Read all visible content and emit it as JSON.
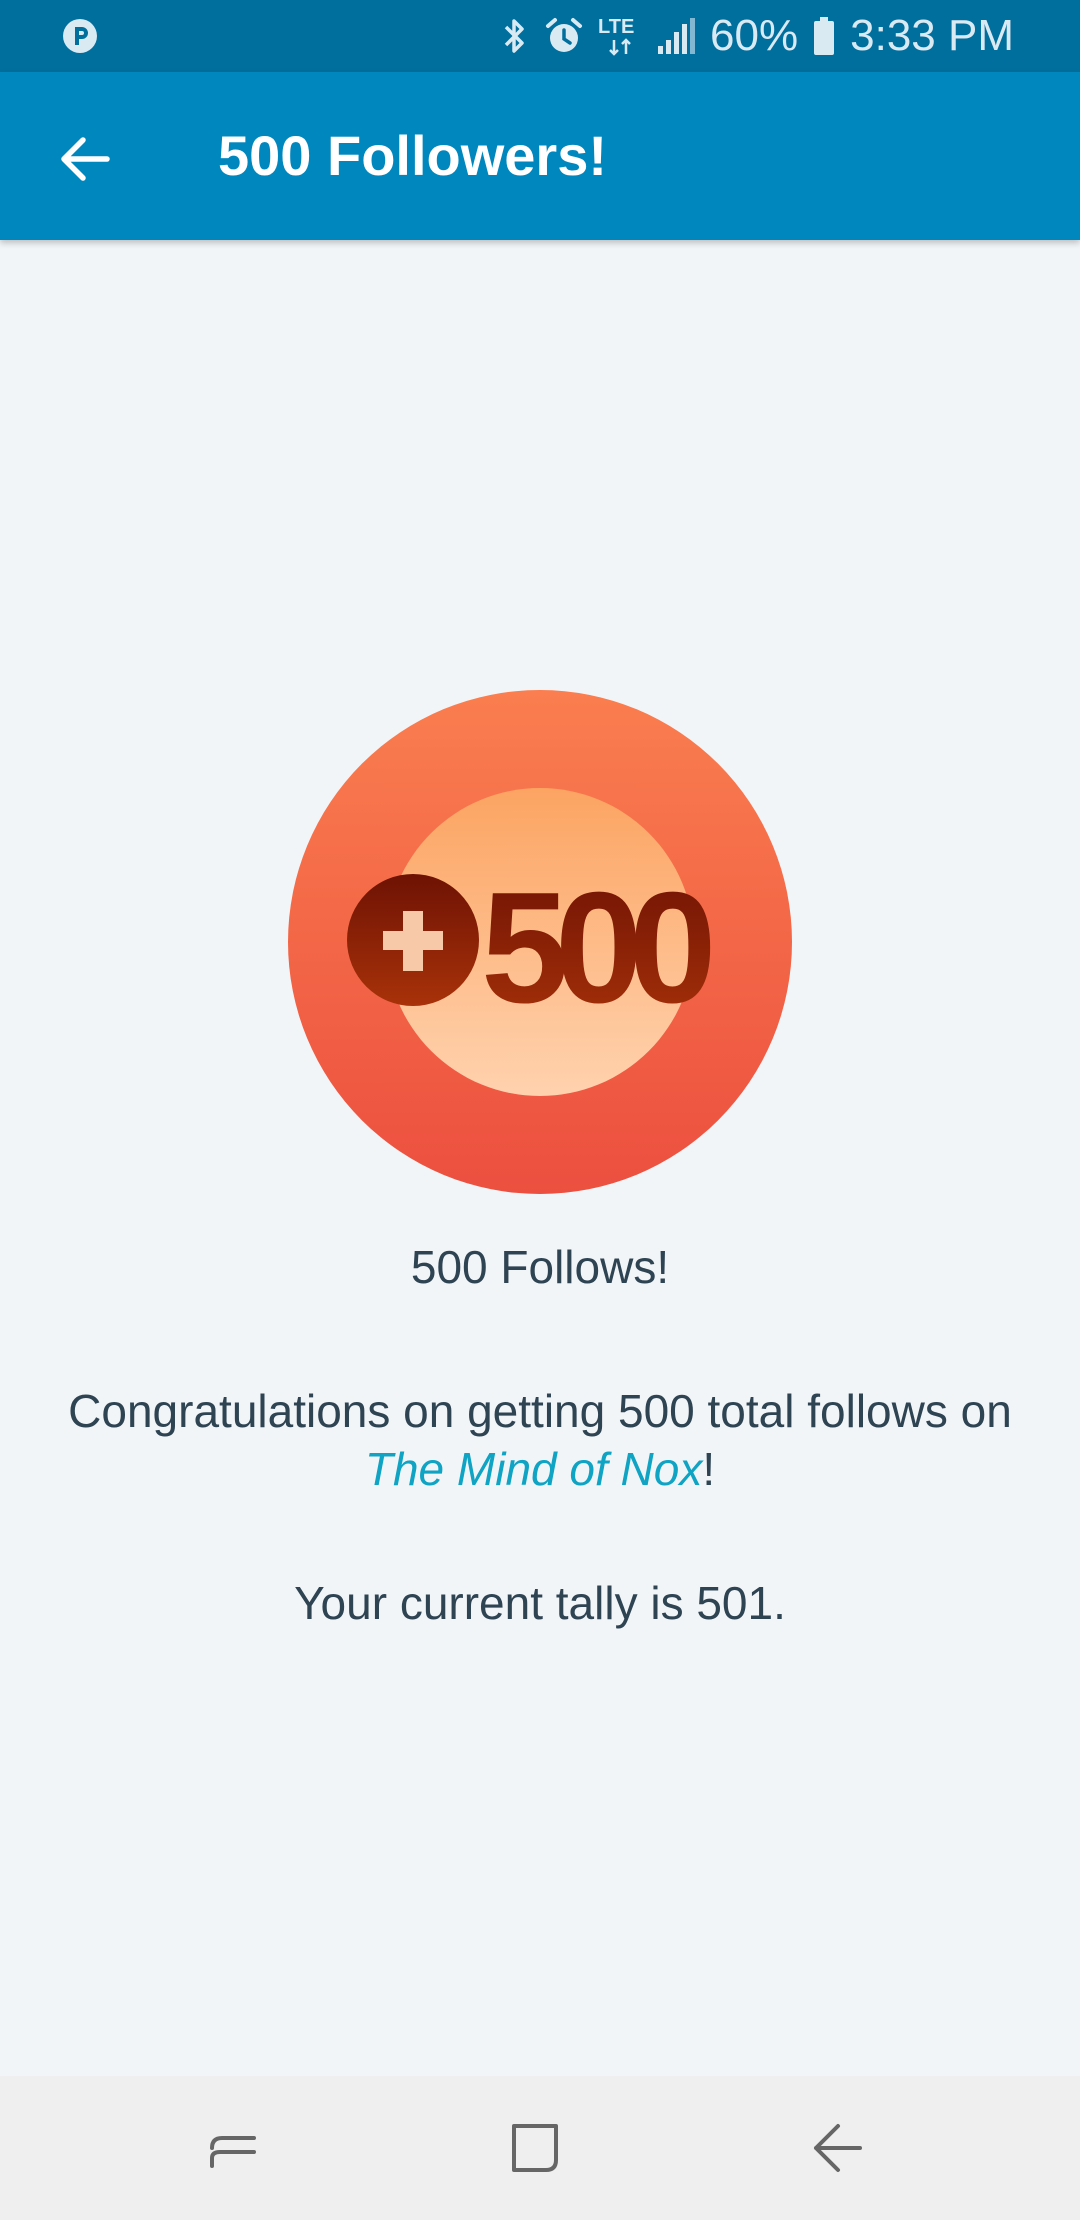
{
  "status_bar": {
    "app_icon": "p-circle-icon",
    "icons": [
      "bluetooth-icon",
      "alarm-icon",
      "lte-icon",
      "signal-icon"
    ],
    "lte_label": "LTE",
    "battery_percent": "60%",
    "battery_icon": "battery-icon",
    "time": "3:33 PM"
  },
  "app_bar": {
    "back_icon": "arrow-back-icon",
    "title": "500 Followers!"
  },
  "badge": {
    "icon": "plus-icon",
    "number": "500"
  },
  "content": {
    "badge_title": "500 Follows!",
    "congrats_prefix": "Congratulations on getting 500 total follows on ",
    "site_name": "The Mind of Nox",
    "congrats_suffix": "!",
    "tally": "Your current tally is 501."
  },
  "nav_bar": {
    "recents_icon": "recents-icon",
    "home_icon": "home-icon",
    "back_icon": "back-nav-icon"
  },
  "colors": {
    "status_bar": "#016f9d",
    "app_bar": "#0087be",
    "background": "#f2f5f8",
    "text": "#2e4453",
    "link": "#0fa3c4",
    "badge_outer_top": "#fa7e4f",
    "badge_outer_bottom": "#ec4f3f",
    "badge_inner_top": "#fca462",
    "badge_inner_bottom": "#ffd2ae",
    "badge_mark": "#8a1f05"
  }
}
